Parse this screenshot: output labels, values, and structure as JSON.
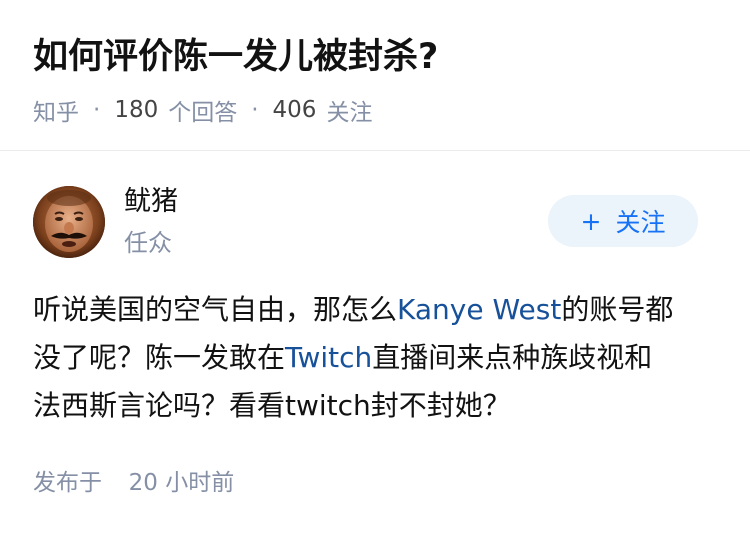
{
  "question": {
    "title": "如何评价陈一发儿被封杀?"
  },
  "meta": {
    "source": "知乎",
    "separator": "·",
    "answer_count": "180",
    "answer_label": "个回答",
    "follower_count": "406",
    "follower_label": "关注"
  },
  "author": {
    "name": "鱿猪",
    "subtitle": "任众",
    "avatar_icon": "avatar-face-icon"
  },
  "follow_button": {
    "plus": "+",
    "label": "关注"
  },
  "content": {
    "line1_pre": "听说美国的空气自由，那怎么",
    "line1_link": "Kanye West",
    "line1_post": "的账号都",
    "line2_pre": "没了呢？陈一发敢在",
    "line2_link": "Twitch",
    "line2_post": "直播间来点种族歧视和",
    "line3": "法西斯言论吗？看看twitch封不封她？"
  },
  "publish": {
    "label": "发布于",
    "time": "20 小时前"
  },
  "colors": {
    "link": "#175199",
    "accent": "#1772f6",
    "muted": "#8590a6",
    "button_bg": "#ebf3fb"
  }
}
